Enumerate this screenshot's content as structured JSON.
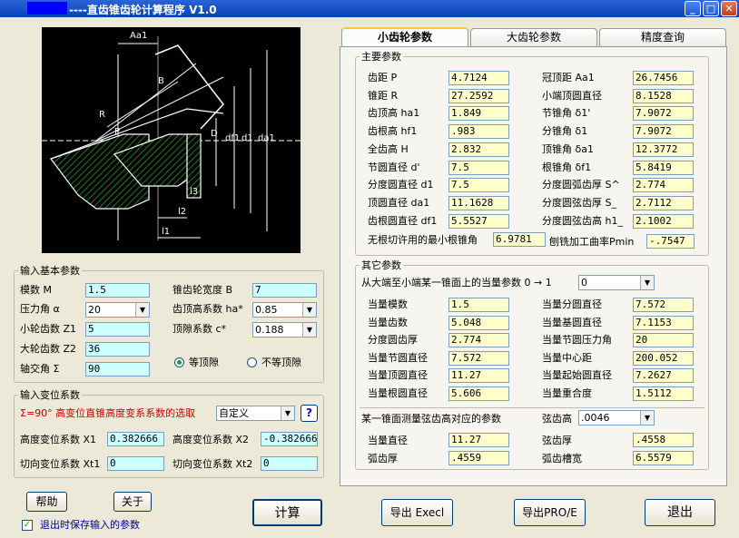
{
  "window": {
    "title": "----直齿锥齿轮计算程序 V1.0"
  },
  "tabs": [
    "小齿轮参数",
    "大齿轮参数",
    "精度查询"
  ],
  "diagram": {
    "labels": {
      "aa1": "Aa1",
      "b": "B",
      "r": "R",
      "p": "P",
      "d": "D",
      "df1": "df1",
      "d1": "d1",
      "da1": "da1",
      "l3": "l3",
      "l2": "l2",
      "l1": "l1"
    }
  },
  "basic": {
    "title": "输入基本参数",
    "module_label": "模数 M",
    "module": "1.5",
    "alpha_label": "压力角  α",
    "alpha": "20",
    "z1_label": "小轮齿数 Z1",
    "z1": "5",
    "z2_label": "大轮齿数 Z2",
    "z2": "36",
    "sigma_label": "轴交角  Σ",
    "sigma": "90",
    "width_label": "锥齿轮宽度 B",
    "width": "7",
    "ha_label": "齿顶高系数 ha*",
    "ha": "0.85",
    "c_label": "顶隙系数 c*",
    "c": "0.188",
    "radio_equal": "等顶隙",
    "radio_unequal": "不等顶隙"
  },
  "shift": {
    "title": "输入变位系数",
    "select_label": "Σ=90° 高变位直锥高度变系系数的选取",
    "select_value": "自定义",
    "help": "?",
    "x1_label": "高度变位系数 X1",
    "x1": "0.382666",
    "x2_label": "高度变位系数 X2",
    "x2": "-0.382666",
    "xt1_label": "切向变位系数 Xt1",
    "xt1": "0",
    "xt2_label": "切向变位系数 Xt2",
    "xt2": "0"
  },
  "main": {
    "title": "主要参数",
    "left": [
      {
        "label": "齿距 P",
        "value": "4.7124"
      },
      {
        "label": "锥距 R",
        "value": "27.2592"
      },
      {
        "label": "齿顶高 ha1",
        "value": "1.849"
      },
      {
        "label": "齿根高 hf1",
        "value": ".983"
      },
      {
        "label": "全齿高 H",
        "value": "2.832"
      },
      {
        "label": "节圆直径 d'",
        "value": "7.5"
      },
      {
        "label": "分度圆直径 d1",
        "value": "7.5"
      },
      {
        "label": "顶圆直径 da1",
        "value": "11.1628"
      },
      {
        "label": "齿根圆直径 df1",
        "value": "5.5527"
      }
    ],
    "right": [
      {
        "label": "冠顶距 Aa1",
        "value": "26.7456"
      },
      {
        "label": "小端顶圆直径",
        "value": "8.1528"
      },
      {
        "label": "节锥角 δ1'",
        "value": "7.9072"
      },
      {
        "label": "分锥角 δ1",
        "value": "7.9072"
      },
      {
        "label": "顶锥角 δa1",
        "value": "12.3772"
      },
      {
        "label": "根锥角 δf1",
        "value": "5.8419"
      },
      {
        "label": "分度圆弧齿厚 S^",
        "value": "2.774"
      },
      {
        "label": "分度圆弦齿厚 S_",
        "value": "2.7112"
      },
      {
        "label": "分度圆弦齿高 h1_",
        "value": "2.1002"
      }
    ],
    "min_root_label": "无根切许用的最小根锥角",
    "min_root": "6.9781",
    "pmin_label": "刨铣加工曲率Pmin",
    "pmin": "-.7547"
  },
  "other": {
    "title": "其它参数",
    "equiv_label": "从大端至小端某一锥面上的当量参数  0 → 1",
    "equiv_select": "0",
    "left": [
      {
        "label": "当量模数",
        "value": "1.5"
      },
      {
        "label": "当量齿数",
        "value": "5.048"
      },
      {
        "label": "分度圆齿厚",
        "value": "2.774"
      },
      {
        "label": "当量节圆直径",
        "value": "7.572"
      },
      {
        "label": "当量顶圆直径",
        "value": "11.27"
      },
      {
        "label": "当量根圆直径",
        "value": "5.606"
      }
    ],
    "right": [
      {
        "label": "当量分圆直径",
        "value": "7.572"
      },
      {
        "label": "当量基圆直径",
        "value": "7.1153"
      },
      {
        "label": "当量节圆压力角",
        "value": "20"
      },
      {
        "label": "当量中心距",
        "value": "200.052"
      },
      {
        "label": "当量起始圆直径",
        "value": "7.2627"
      },
      {
        "label": "当量重合度",
        "value": "1.5112"
      }
    ],
    "measure_label": "某一锥面测量弦齿高对应的参数",
    "chord_h_label": "弦齿高",
    "chord_h": ".0046",
    "eq_dia_label": "当量直径",
    "eq_dia": "11.27",
    "chord_t_label": "弦齿厚",
    "chord_t": ".4558",
    "arc_t_label": "弧齿厚",
    "arc_t": ".4559",
    "arc_slot_label": "弧齿槽宽",
    "arc_slot": "6.5579"
  },
  "buttons": {
    "help": "帮助",
    "about": "关于",
    "calc": "计算",
    "export_excel": "导出 Execl",
    "export_pro": "导出PRO/E",
    "exit": "退出"
  },
  "save_check": "退出时保存输入的参数",
  "colors": {
    "titlebar": "#0a3fb8",
    "input_cyan": "#ccffff",
    "output_yellow": "#ffffcc",
    "red_text": "#cc0000"
  }
}
